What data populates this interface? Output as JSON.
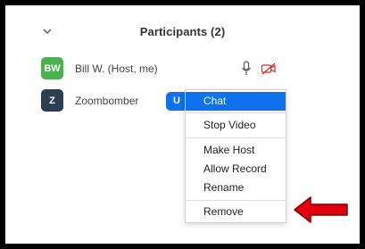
{
  "panel": {
    "title": "Participants (2)"
  },
  "participants": [
    {
      "initials": "BW",
      "name": "Bill W. (Host, me)",
      "avatar_color": "#4caf50",
      "mic_icon": "microphone-icon",
      "video_icon": "video-off-icon"
    },
    {
      "initials": "Z",
      "name": "Zoombomber",
      "avatar_color": "#2d3e50",
      "button_label": "U"
    }
  ],
  "context_menu": {
    "items": [
      "Chat",
      "Stop Video",
      "Make Host",
      "Allow Record",
      "Rename",
      "Remove"
    ],
    "active_item": "Chat"
  },
  "colors": {
    "accent": "#0e72ed",
    "muted_red": "#e02828",
    "annotation_arrow": "#e0000f"
  },
  "annotation": {
    "icon": "red-arrow-pointing-left-icon"
  }
}
